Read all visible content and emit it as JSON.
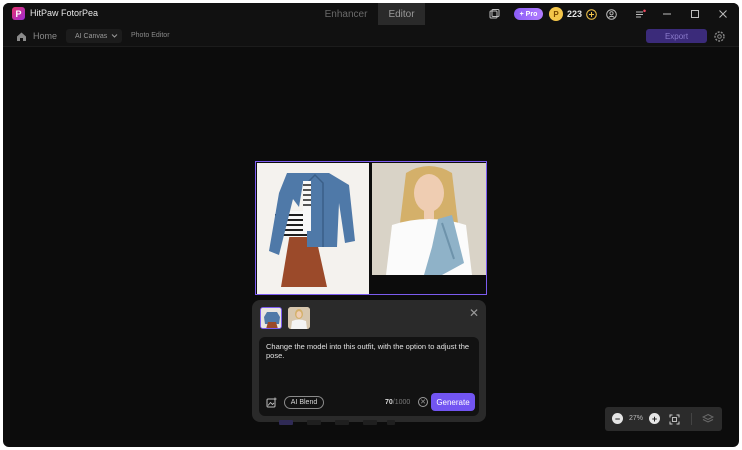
{
  "app": {
    "title": "HitPaw FotorPea",
    "logo_letter": "P"
  },
  "tabs": [
    {
      "label": "Enhancer"
    },
    {
      "label": "Editor"
    }
  ],
  "titlebar": {
    "pro_label": "+ Pro",
    "credits": "223",
    "icons": [
      "history-icon",
      "add-credits-icon",
      "account-icon",
      "menu-icon",
      "minimize-icon",
      "maximize-icon",
      "close-icon"
    ]
  },
  "toolbar": {
    "home_label": "Home",
    "mode_select": "AI Canvas",
    "photo_editor_label": "Photo Editor",
    "export_label": "Export"
  },
  "panel": {
    "prompt": "Change the model into this outfit, with the option to adjust the pose.",
    "ai_blend_label": "AI Blend",
    "char_count": "70",
    "char_limit": "/1000",
    "generate_label": "Generate",
    "close_glyph": "✕",
    "clear_glyph": "✕"
  },
  "zoom": {
    "level": "27%",
    "minus": "−",
    "plus": "+"
  },
  "colors": {
    "accent": "#7255f2",
    "pro_badge": "#8a5cf6",
    "coin": "#f4c64a",
    "background": "#0c0c0c"
  }
}
